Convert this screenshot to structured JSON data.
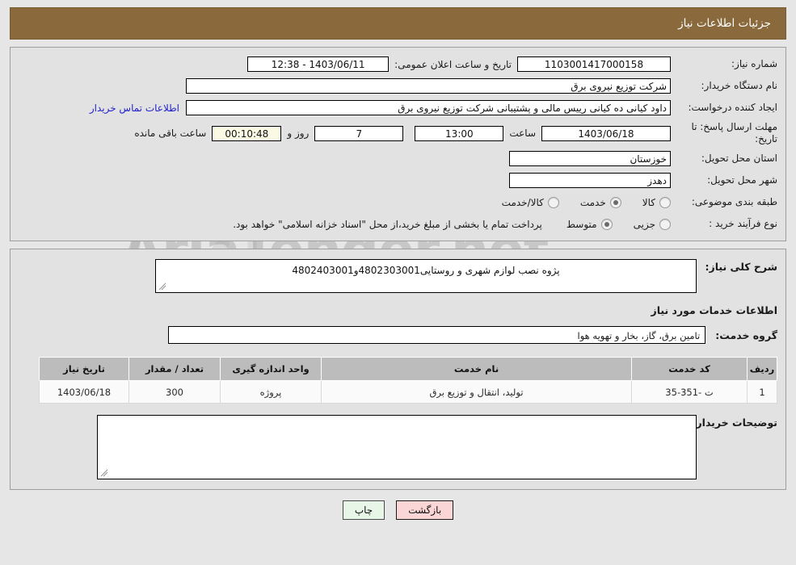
{
  "header": {
    "title": "جزئیات اطلاعات نیاز"
  },
  "form": {
    "need_number_label": "شماره نیاز:",
    "need_number_value": "1103001417000158",
    "announce_label": "تاریخ و ساعت اعلان عمومی:",
    "announce_value": "1403/06/11 - 12:38",
    "buyer_org_label": "نام دستگاه خریدار:",
    "buyer_org_value": "شرکت توزیع نیروی برق",
    "creator_label": "ایجاد کننده درخواست:",
    "creator_value": "داود کیانی ده کیانی رییس مالی و پشتیبانی  شرکت توزیع نیروی برق",
    "contact_link": "اطلاعات تماس خریدار",
    "deadline_label": "مهلت ارسال پاسخ: تا تاریخ:",
    "deadline_date": "1403/06/18",
    "deadline_hour_label": "ساعت",
    "deadline_hour": "13:00",
    "remaining_days": "7",
    "remaining_days_label": "روز و",
    "remaining_time": "00:10:48",
    "remaining_time_label": "ساعت باقی مانده",
    "province_label": "استان محل تحویل:",
    "province_value": "خوزستان",
    "city_label": "شهر محل تحویل:",
    "city_value": "دهدز",
    "category_label": "طبقه بندی موضوعی:",
    "category_options": [
      {
        "label": "کالا",
        "selected": false
      },
      {
        "label": "خدمت",
        "selected": true
      },
      {
        "label": "کالا/خدمت",
        "selected": false
      }
    ],
    "process_label": "نوع فرآیند خرید :",
    "process_options": [
      {
        "label": "جزیی",
        "selected": false
      },
      {
        "label": "متوسط",
        "selected": true
      }
    ],
    "process_note": "پرداخت تمام یا بخشی از مبلغ خرید،از محل \"اسناد خزانه اسلامی\" خواهد بود."
  },
  "details": {
    "general_desc_label": "شرح کلی نیاز:",
    "general_desc_value": "پژوه نصب لوازم شهری و روستایی4802303001و4802403001",
    "services_section_title": "اطلاعات خدمات مورد نیاز",
    "service_group_label": "گروه خدمت:",
    "service_group_value": "تامین برق، گاز، بخار و تهویه هوا"
  },
  "table": {
    "headers": [
      "ردیف",
      "کد خدمت",
      "نام خدمت",
      "واحد اندازه گیری",
      "تعداد / مقدار",
      "تاریخ نیاز"
    ],
    "rows": [
      {
        "row": "1",
        "code": "ت -351-35",
        "name": "تولید، انتقال و توزیع برق",
        "unit": "پروژه",
        "qty": "300",
        "date": "1403/06/18"
      }
    ]
  },
  "notes": {
    "label": "توضیحات خریدار:",
    "value": ""
  },
  "buttons": {
    "print": "چاپ",
    "back": "بازگشت"
  },
  "colors": {
    "header_bg": "#8a6a3c",
    "link": "#2222cc",
    "print_bg": "#e8f6e8",
    "back_bg": "#fbd6d6",
    "table_header_bg": "#bcbcbc"
  }
}
